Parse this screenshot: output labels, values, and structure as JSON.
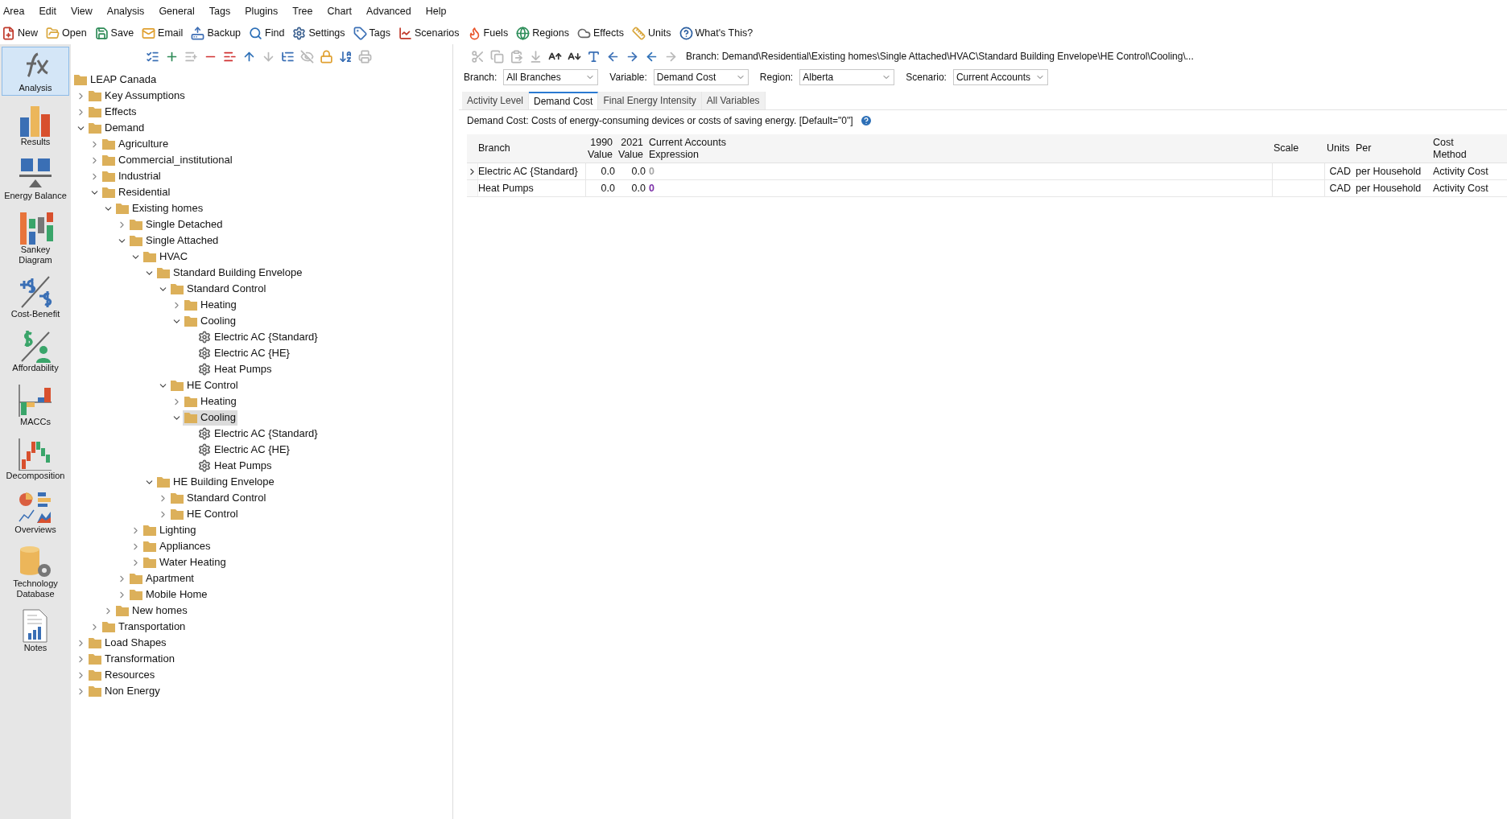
{
  "menu": [
    "Area",
    "Edit",
    "View",
    "Analysis",
    "General",
    "Tags",
    "Plugins",
    "Tree",
    "Chart",
    "Advanced",
    "Help"
  ],
  "main_toolbar": [
    "New",
    "Open",
    "Save",
    "Email",
    "Backup",
    "Find",
    "Settings",
    "Tags",
    "Scenarios",
    "Fuels",
    "Regions",
    "Effects",
    "Units",
    "What's This?"
  ],
  "sidebar": [
    {
      "label": "Analysis",
      "selected": true
    },
    {
      "label": "Results",
      "selected": false
    },
    {
      "label": "Energy Balance",
      "selected": false
    },
    {
      "label": "Sankey\nDiagram",
      "selected": false
    },
    {
      "label": "Cost-Benefit",
      "selected": false
    },
    {
      "label": "Affordability",
      "selected": false
    },
    {
      "label": "MACCs",
      "selected": false
    },
    {
      "label": "Decomposition",
      "selected": false
    },
    {
      "label": "Overviews",
      "selected": false
    },
    {
      "label": "Technology\nDatabase",
      "selected": false
    },
    {
      "label": "Notes",
      "selected": false
    }
  ],
  "tree_toolbar": [
    {
      "disabled": false
    },
    {
      "disabled": false
    },
    {
      "disabled": true
    },
    {
      "disabled": false
    },
    {
      "disabled": false
    },
    {
      "disabled": false
    },
    {
      "disabled": true
    },
    {
      "disabled": false
    },
    {
      "disabled": true
    },
    {
      "disabled": false
    },
    {
      "disabled": false
    },
    {
      "disabled": true
    }
  ],
  "tree": {
    "root": "LEAP Canada",
    "children": [
      {
        "label": "Key Assumptions",
        "kind": "folder",
        "expanded": false,
        "selected": false
      },
      {
        "label": "Effects",
        "kind": "folder",
        "expanded": false,
        "selected": false
      },
      {
        "label": "Demand",
        "kind": "folder",
        "expanded": true,
        "selected": false,
        "children": [
          {
            "label": "Agriculture",
            "kind": "folder",
            "expanded": false,
            "selected": false
          },
          {
            "label": "Commercial_institutional",
            "kind": "folder",
            "expanded": false,
            "selected": false
          },
          {
            "label": "Industrial",
            "kind": "folder",
            "expanded": false,
            "selected": false
          },
          {
            "label": "Residential",
            "kind": "folder",
            "expanded": true,
            "selected": false,
            "children": [
              {
                "label": "Existing homes",
                "kind": "folder",
                "expanded": true,
                "selected": false,
                "children": [
                  {
                    "label": "Single Detached",
                    "kind": "folder",
                    "expanded": false,
                    "selected": false
                  },
                  {
                    "label": "Single Attached",
                    "kind": "folder",
                    "expanded": true,
                    "selected": false,
                    "children": [
                      {
                        "label": "HVAC",
                        "kind": "folder",
                        "expanded": true,
                        "selected": false,
                        "children": [
                          {
                            "label": "Standard Building Envelope",
                            "kind": "folder",
                            "expanded": true,
                            "selected": false,
                            "children": [
                              {
                                "label": "Standard Control",
                                "kind": "folder",
                                "expanded": true,
                                "selected": false,
                                "children": [
                                  {
                                    "label": "Heating",
                                    "kind": "folder",
                                    "expanded": false,
                                    "selected": false
                                  },
                                  {
                                    "label": "Cooling",
                                    "kind": "folder",
                                    "expanded": true,
                                    "selected": false,
                                    "children": [
                                      {
                                        "label": "Electric AC {Standard}",
                                        "kind": "device",
                                        "selected": false
                                      },
                                      {
                                        "label": "Electric AC {HE}",
                                        "kind": "device",
                                        "selected": false
                                      },
                                      {
                                        "label": "Heat Pumps",
                                        "kind": "device",
                                        "selected": false
                                      }
                                    ]
                                  }
                                ]
                              },
                              {
                                "label": "HE Control",
                                "kind": "folder",
                                "expanded": true,
                                "selected": false,
                                "children": [
                                  {
                                    "label": "Heating",
                                    "kind": "folder",
                                    "expanded": false,
                                    "selected": false
                                  },
                                  {
                                    "label": "Cooling",
                                    "kind": "folder",
                                    "expanded": true,
                                    "selected": true,
                                    "children": [
                                      {
                                        "label": "Electric AC {Standard}",
                                        "kind": "device",
                                        "selected": false
                                      },
                                      {
                                        "label": "Electric AC {HE}",
                                        "kind": "device",
                                        "selected": false
                                      },
                                      {
                                        "label": "Heat Pumps",
                                        "kind": "device",
                                        "selected": false
                                      }
                                    ]
                                  }
                                ]
                              }
                            ]
                          },
                          {
                            "label": "HE Building Envelope",
                            "kind": "folder",
                            "expanded": true,
                            "selected": false,
                            "children": [
                              {
                                "label": "Standard Control",
                                "kind": "folder",
                                "expanded": false,
                                "selected": false
                              },
                              {
                                "label": "HE Control",
                                "kind": "folder",
                                "expanded": false,
                                "selected": false
                              }
                            ]
                          }
                        ]
                      },
                      {
                        "label": "Lighting",
                        "kind": "folder",
                        "expanded": false,
                        "selected": false
                      },
                      {
                        "label": "Appliances",
                        "kind": "folder",
                        "expanded": false,
                        "selected": false
                      },
                      {
                        "label": "Water Heating",
                        "kind": "folder",
                        "expanded": false,
                        "selected": false
                      }
                    ]
                  },
                  {
                    "label": "Apartment",
                    "kind": "folder",
                    "expanded": false,
                    "selected": false
                  },
                  {
                    "label": "Mobile Home",
                    "kind": "folder",
                    "expanded": false,
                    "selected": false
                  }
                ]
              },
              {
                "label": "New homes",
                "kind": "folder",
                "expanded": false,
                "selected": false
              }
            ]
          },
          {
            "label": "Transportation",
            "kind": "folder",
            "expanded": false,
            "selected": false
          }
        ]
      },
      {
        "label": "Load Shapes",
        "kind": "folder",
        "expanded": false,
        "selected": false
      },
      {
        "label": "Transformation",
        "kind": "folder",
        "expanded": false,
        "selected": false
      },
      {
        "label": "Resources",
        "kind": "folder",
        "expanded": false,
        "selected": false
      },
      {
        "label": "Non Energy",
        "kind": "folder",
        "expanded": false,
        "selected": false
      }
    ]
  },
  "edit_toolbar": [
    {
      "disabled": true
    },
    {
      "disabled": true
    },
    {
      "disabled": true
    },
    {
      "disabled": true
    },
    {
      "disabled": false
    },
    {
      "disabled": false
    },
    {
      "disabled": false
    },
    {
      "disabled": false
    },
    {
      "disabled": false
    },
    {
      "disabled": false
    },
    {
      "disabled": true
    }
  ],
  "breadcrumb": "Branch: Demand\\Residential\\Existing homes\\Single Attached\\HVAC\\Standard Building Envelope\\HE Control\\Cooling\\...",
  "filters": [
    {
      "label": "Branch:",
      "value": "All Branches"
    },
    {
      "label": "Variable:",
      "value": "Demand Cost"
    },
    {
      "label": "Region:",
      "value": "Alberta"
    },
    {
      "label": "Scenario:",
      "value": "Current Accounts"
    }
  ],
  "tabs": [
    {
      "label": "Activity Level",
      "selected": false
    },
    {
      "label": "Demand Cost",
      "selected": true
    },
    {
      "label": "Final Energy Intensity",
      "selected": false
    },
    {
      "label": "All Variables",
      "selected": false
    }
  ],
  "description": "Demand Cost: Costs of energy-consuming devices or costs of saving energy. [Default=\"0\"]",
  "table": {
    "columns": [
      "Branch",
      "1990\nValue",
      "2021\nValue",
      "Current Accounts\nExpression",
      "Scale",
      "Units",
      "Per",
      "Cost\nMethod"
    ],
    "rows": [
      {
        "current": true,
        "cells": [
          "Electric AC {Standard}",
          "0.0",
          "0.0"
        ],
        "expression": {
          "text": "0",
          "color": "#a6a6a6"
        },
        "scale": "",
        "units": "CAD",
        "per": "per Household",
        "method": "Activity Cost"
      },
      {
        "current": false,
        "cells": [
          "Heat Pumps",
          "0.0",
          "0.0"
        ],
        "expression": {
          "text": "0",
          "color": "#7b2fa8"
        },
        "scale": "",
        "units": "CAD",
        "per": "per Household",
        "method": "Activity Cost"
      }
    ]
  }
}
